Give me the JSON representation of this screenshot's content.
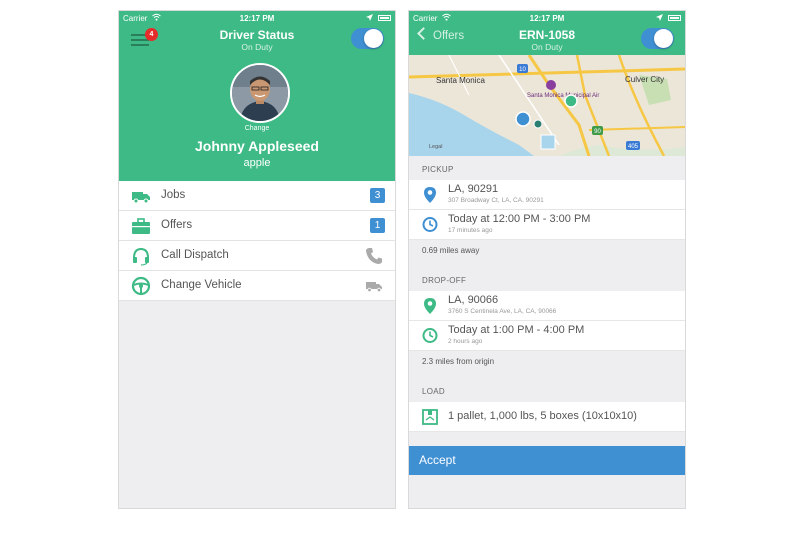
{
  "left": {
    "status": {
      "carrier": "Carrier",
      "time": "12:17 PM"
    },
    "title": "Driver Status",
    "subtitle": "On Duty",
    "menu_badge": "4",
    "change_label": "Change",
    "user_name": "Johnny Appleseed",
    "user_sub": "apple",
    "menu_items": [
      {
        "label": "Jobs",
        "count": "3",
        "icon": "truck-icon"
      },
      {
        "label": "Offers",
        "count": "1",
        "icon": "briefcase-icon"
      },
      {
        "label": "Call Dispatch",
        "icon": "headset-icon",
        "right_icon": "phone-icon"
      },
      {
        "label": "Change Vehicle",
        "icon": "steering-wheel-icon",
        "right_icon": "truck-icon"
      }
    ],
    "toggle_on": true
  },
  "right": {
    "status": {
      "carrier": "Carrier",
      "time": "12:17 PM"
    },
    "back_label": "Offers",
    "title": "ERN-1058",
    "subtitle": "On Duty",
    "toggle_on": true,
    "map": {
      "labels": [
        "Santa Monica",
        "Culver City",
        "Santa Monica Municipal Airport",
        "Legal"
      ],
      "road_shields": [
        "10",
        "90",
        "405"
      ]
    },
    "pickup": {
      "header": "PICKUP",
      "location": "LA, 90291",
      "address": "307 Broadway Ct, LA, CA, 90291",
      "time": "Today at 12:00 PM - 3:00 PM",
      "time_ago": "17 minutes ago",
      "distance": "0.69 miles away"
    },
    "dropoff": {
      "header": "DROP-OFF",
      "location": "LA, 90066",
      "address": "3760 S Centinela Ave, LA, CA, 90066",
      "time": "Today at 1:00 PM - 4:00 PM",
      "time_ago": "2 hours ago",
      "distance": "2.3 miles from origin"
    },
    "load": {
      "header": "LOAD",
      "description": "1 pallet, 1,000 lbs, 5 boxes (10x10x10)"
    },
    "accept_label": "Accept"
  },
  "colors": {
    "green": "#3dba85",
    "blue": "#3f8fd3",
    "badge_red": "#e62b2b"
  }
}
